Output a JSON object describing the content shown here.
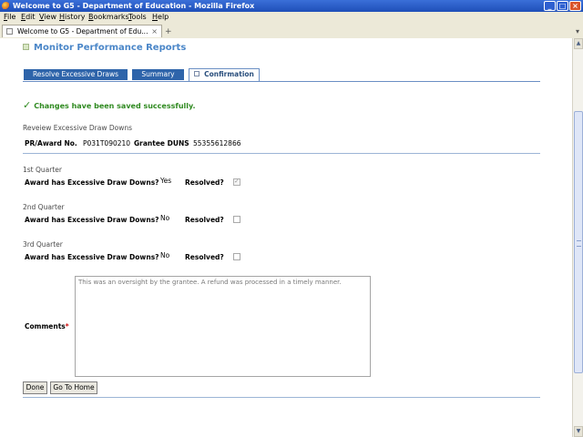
{
  "window": {
    "title": "Welcome to G5 - Department of Education - Mozilla Firefox"
  },
  "menu": [
    "File",
    "Edit",
    "View",
    "History",
    "Bookmarks",
    "Tools",
    "Help"
  ],
  "browser_tab": {
    "title": "Welcome to G5 - Department of Edu...",
    "close": "×",
    "new_tab": "+"
  },
  "page": {
    "title": "Monitor Performance Reports",
    "wizard_tabs": [
      "Resolve Excessive Draws",
      "Summary",
      "Confirmation"
    ],
    "success_message": "Changes have been saved successfully.",
    "review_heading": "Reveiew Excessive Draw Downs",
    "pr_award_label": "PR/Award No.",
    "pr_award_value": "P031T090210",
    "duns_label": "Grantee DUNS",
    "duns_value": "55355612866",
    "quarters": [
      {
        "name": "1st Quarter",
        "question": "Award has Excessive Draw Downs?",
        "answer": "Yes",
        "resolved_label": "Resolved?",
        "resolved": true
      },
      {
        "name": "2nd Quarter",
        "question": "Award has Excessive Draw Downs?",
        "answer": "No",
        "resolved_label": "Resolved?",
        "resolved": false
      },
      {
        "name": "3rd Quarter",
        "question": "Award has Excessive Draw Downs?",
        "answer": "No",
        "resolved_label": "Resolved?",
        "resolved": false
      }
    ],
    "comments_label": "Comments",
    "comments_required": "*",
    "comments_text": "This was an oversight by the grantee.  A refund was processed in a timely manner.",
    "buttons": {
      "done": "Done",
      "home": "Go To Home"
    }
  }
}
